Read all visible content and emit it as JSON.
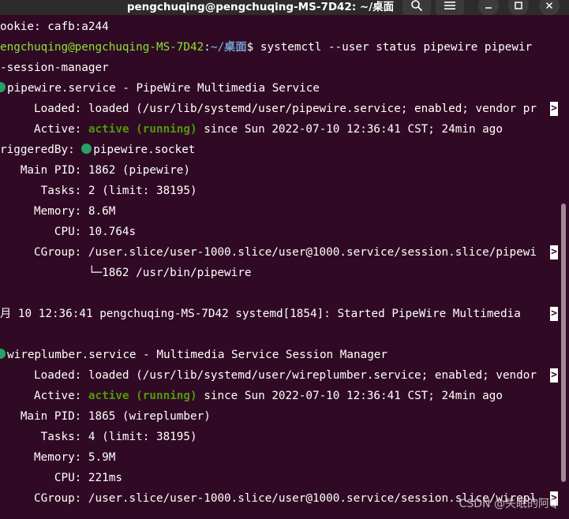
{
  "window": {
    "title": "pengchuqing@pengchuqing-MS-7D42: ~/桌面",
    "buttons": [
      "search",
      "menu",
      "minimize",
      "maximize",
      "close"
    ]
  },
  "terminal": {
    "lines": [
      {
        "segments": [
          {
            "t": "ookie: cafb:a244"
          }
        ]
      },
      {
        "segments": [
          {
            "t": "engchuqing@pengchuqing-MS-7D42",
            "c": "green"
          },
          {
            "t": ":"
          },
          {
            "t": "~/桌面",
            "c": "blue"
          },
          {
            "t": "$ systemctl --user status pipewire pipewir"
          }
        ]
      },
      {
        "segments": [
          {
            "t": "-session-manager"
          }
        ]
      },
      {
        "dot": "edge",
        "segments": [
          {
            "t": "pipewire.service - PipeWire Multimedia Service"
          }
        ]
      },
      {
        "segments": [
          {
            "t": "     Loaded: loaded (/usr/lib/systemd/user/pipewire.service; enabled; vendor pr"
          }
        ],
        "trunc": true
      },
      {
        "segments": [
          {
            "t": "     Active: "
          },
          {
            "t": "active (running)",
            "c": "agreen"
          },
          {
            "t": " since Sun 2022-07-10 12:36:41 CST; 24min ago"
          }
        ]
      },
      {
        "segments": [
          {
            "t": "riggeredBy: "
          }
        ],
        "dot": "inline",
        "after": [
          {
            "t": "pipewire.socket"
          }
        ]
      },
      {
        "segments": [
          {
            "t": "   Main PID: 1862 (pipewire)"
          }
        ]
      },
      {
        "segments": [
          {
            "t": "      Tasks: 2 (limit: 38195)"
          }
        ]
      },
      {
        "segments": [
          {
            "t": "     Memory: 8.6M"
          }
        ]
      },
      {
        "segments": [
          {
            "t": "        CPU: 10.764s"
          }
        ]
      },
      {
        "segments": [
          {
            "t": "     CGroup: /user.slice/user-1000.slice/user@1000.service/session.slice/pipewi"
          }
        ],
        "trunc": true
      },
      {
        "segments": [
          {
            "t": "             └─1862 /usr/bin/pipewire"
          }
        ]
      },
      {
        "segments": [
          {
            "t": ""
          }
        ]
      },
      {
        "segments": [
          {
            "t": "月 10 12:36:41 pengchuqing-MS-7D42 systemd[1854]: Started PipeWire Multimedia "
          }
        ],
        "trunc": true
      },
      {
        "segments": [
          {
            "t": ""
          }
        ]
      },
      {
        "dot": "edge",
        "segments": [
          {
            "t": "wireplumber.service - Multimedia Service Session Manager"
          }
        ]
      },
      {
        "segments": [
          {
            "t": "     Loaded: loaded (/usr/lib/systemd/user/wireplumber.service; enabled; vendor"
          }
        ],
        "trunc": true
      },
      {
        "segments": [
          {
            "t": "     Active: "
          },
          {
            "t": "active (running)",
            "c": "agreen"
          },
          {
            "t": " since Sun 2022-07-10 12:36:41 CST; 24min ago"
          }
        ]
      },
      {
        "segments": [
          {
            "t": "   Main PID: 1865 (wireplumber)"
          }
        ]
      },
      {
        "segments": [
          {
            "t": "      Tasks: 4 (limit: 38195)"
          }
        ]
      },
      {
        "segments": [
          {
            "t": "     Memory: 5.9M"
          }
        ]
      },
      {
        "segments": [
          {
            "t": "        CPU: 221ms"
          }
        ]
      },
      {
        "segments": [
          {
            "t": "     CGroup: /user.slice/user-1000.slice/user@1000.service/session.slice/wirepl"
          }
        ],
        "trunc": true
      }
    ]
  },
  "watermark": "CSDN @失眠的阿Q"
}
